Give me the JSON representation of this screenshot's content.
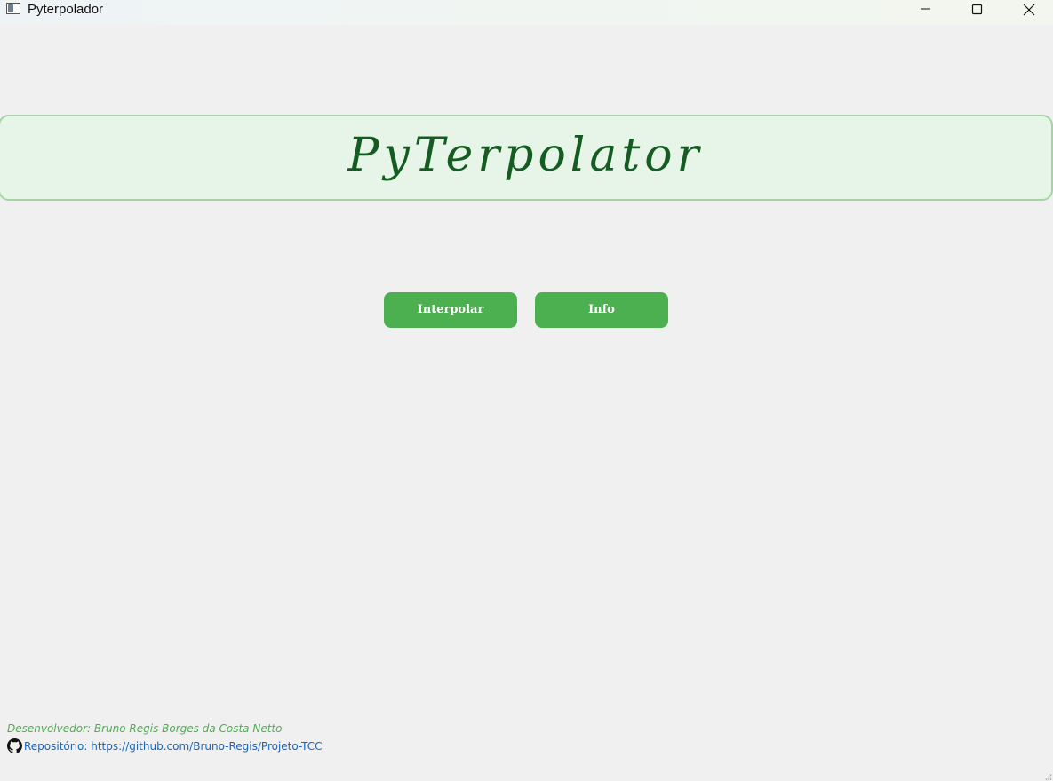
{
  "window": {
    "title": "Pyterpolador",
    "controls": {
      "minimize_icon": "minimize-icon",
      "maximize_icon": "maximize-icon",
      "close_icon": "close-icon"
    }
  },
  "banner": {
    "title": "PyTerpolator",
    "background": "#e7f4e8",
    "border": "#a5d3a6",
    "text_color": "#155c22"
  },
  "actions": {
    "interpolar_label": "Interpolar",
    "info_label": "Info",
    "button_color": "#4caf50"
  },
  "footer": {
    "developer": "Desenvolvedor: Bruno Regis Borges da Costa Netto",
    "repository": "Repositório: https://github.com/Bruno-Regis/Projeto-TCC",
    "repo_icon": "github-icon",
    "developer_color": "#4caf50",
    "link_color": "#1565c0"
  }
}
